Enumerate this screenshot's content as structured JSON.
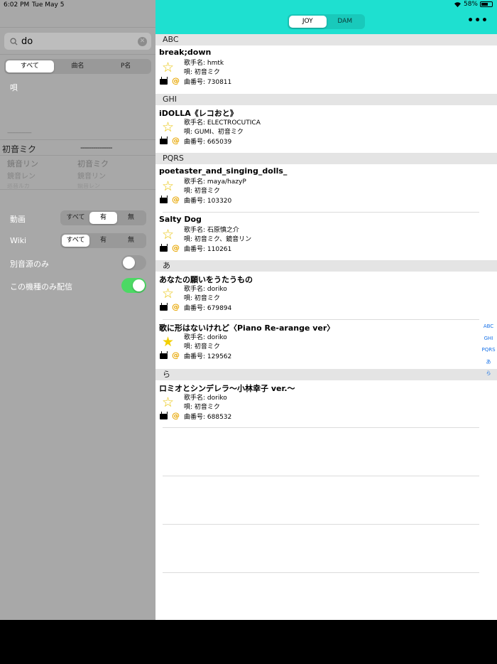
{
  "status_bar": {
    "time": "6:02 PM",
    "date": "Tue May 5",
    "battery": "58%",
    "battery_level": 0.58
  },
  "sidebar": {
    "search": {
      "value": "do"
    },
    "filter_tabs": [
      "すべて",
      "曲名",
      "P名"
    ],
    "filter_selected": 0,
    "uta_label": "唄",
    "dashes_1": "---------------",
    "singer_header": "初音ミク",
    "singer_dashes": "---------------",
    "picker_left": [
      "鏡音リン",
      "鏡音レン",
      "巡音ルカ"
    ],
    "picker_right": [
      "初音ミク",
      "鏡音リン",
      "鏡音レン"
    ],
    "video": {
      "label": "動画",
      "options": [
        "すべて",
        "有",
        "無"
      ],
      "selected": 1
    },
    "wiki": {
      "label": "Wiki",
      "options": [
        "すべて",
        "有",
        "無"
      ],
      "selected": 0
    },
    "alt_source": {
      "label": "別音源のみ",
      "on": false
    },
    "device_only": {
      "label": "この機種のみ配信",
      "on": true
    }
  },
  "nav": {
    "db_options": [
      "JOY",
      "DAM"
    ],
    "db_selected": 0,
    "more": "•••"
  },
  "sections": [
    {
      "header": "ABC",
      "songs": [
        {
          "title": "break;down",
          "artist": "歌手名: hmtk",
          "singer": "唄: 初音ミク",
          "number": "曲番号: 730811",
          "fav": false
        }
      ]
    },
    {
      "header": "GHI",
      "songs": [
        {
          "title": "iDOLLA《レコおと》",
          "artist": "歌手名: ELECTROCUTICA",
          "singer": "唄: GUMI、初音ミク",
          "number": "曲番号: 665039",
          "fav": false
        }
      ]
    },
    {
      "header": "PQRS",
      "songs": [
        {
          "title": "poetaster_and_singing_dolls_",
          "artist": "歌手名: maya/hazyP",
          "singer": "唄: 初音ミク",
          "number": "曲番号: 103320",
          "fav": false
        },
        {
          "title": "Salty Dog",
          "artist": "歌手名: 石原慎之介",
          "singer": "唄: 初音ミク、鏡音リン",
          "number": "曲番号: 110261",
          "fav": false
        }
      ]
    },
    {
      "header": "あ",
      "songs": [
        {
          "title": "あなたの願いをうたうもの",
          "artist": "歌手名: doriko",
          "singer": "唄: 初音ミク",
          "number": "曲番号: 679894",
          "fav": false
        },
        {
          "title": "歌に形はないけれど〈Piano Re-arange ver〉",
          "artist": "歌手名: doriko",
          "singer": "唄: 初音ミク",
          "number": "曲番号: 129562",
          "fav": true
        }
      ]
    },
    {
      "header": "ら",
      "songs": [
        {
          "title": "ロミオとシンデレラ～小林幸子 ver.～",
          "artist": "歌手名: doriko",
          "singer": "唄: 初音ミク",
          "number": "曲番号: 688532",
          "fav": false
        }
      ]
    }
  ],
  "icons": {
    "star_empty": "☆",
    "star_filled": "★",
    "at": "@",
    "clear": "✕"
  },
  "index_bar": [
    "ABC",
    "GHI",
    "PQRS",
    "あ",
    "ら"
  ],
  "colors": {
    "nav_bg": "#1ee0d0",
    "sidebar_bg": "#a8a8a8",
    "star": "#f2cf00",
    "index": "#1a73e8",
    "toggle_on": "#4cd964"
  }
}
